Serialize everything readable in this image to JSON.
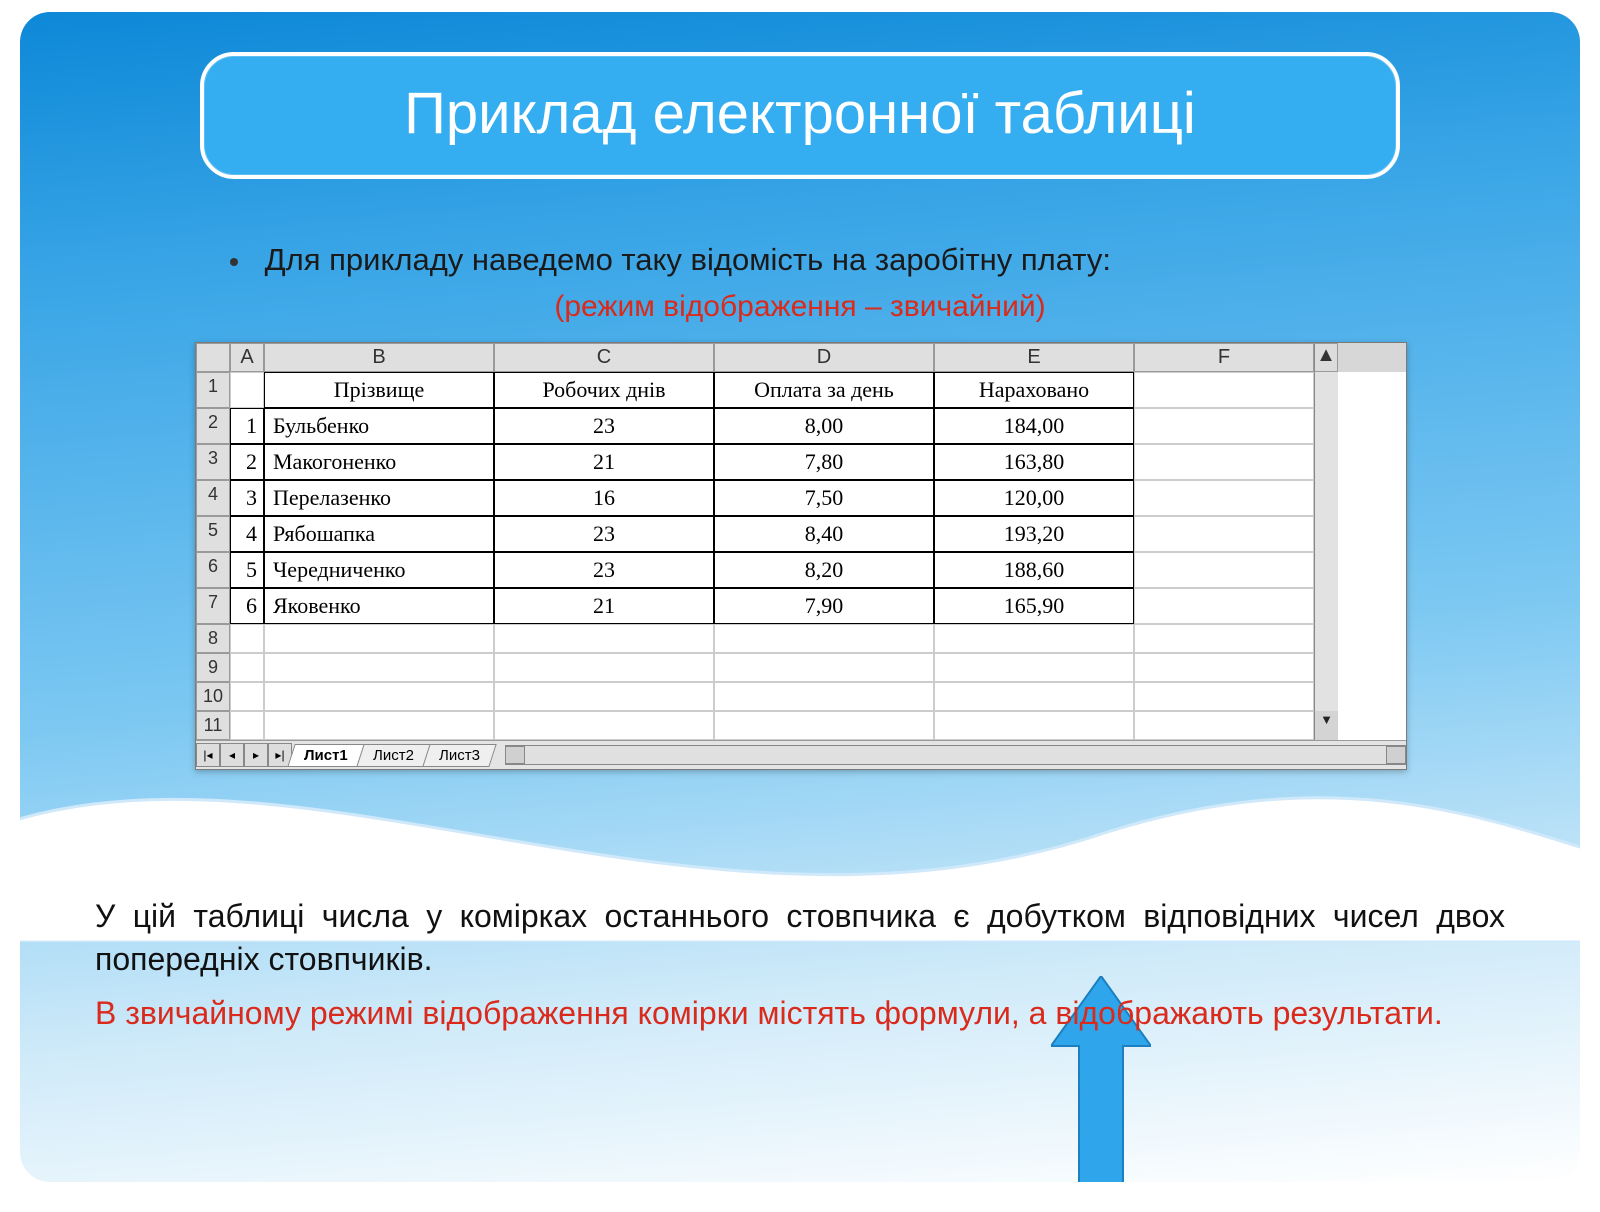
{
  "title": "Приклад електронної таблиці",
  "bullet": "Для прикладу наведемо таку відомість на заробітну плату:",
  "subnote": "(режим відображення – звичайний)",
  "columns": [
    "A",
    "B",
    "C",
    "D",
    "E",
    "F"
  ],
  "headers": {
    "b": "Прізвище",
    "c": "Робочих днів",
    "d": "Оплата за день",
    "e": "Нараховано"
  },
  "rows": [
    {
      "n": "1",
      "name": "Бульбенко",
      "days": "23",
      "rate": "8,00",
      "sum": "184,00"
    },
    {
      "n": "2",
      "name": "Макогоненко",
      "days": "21",
      "rate": "7,80",
      "sum": "163,80"
    },
    {
      "n": "3",
      "name": "Перелазенко",
      "days": "16",
      "rate": "7,50",
      "sum": "120,00"
    },
    {
      "n": "4",
      "name": "Рябошапка",
      "days": "23",
      "rate": "8,40",
      "sum": "193,20"
    },
    {
      "n": "5",
      "name": "Чередниченко",
      "days": "23",
      "rate": "8,20",
      "sum": "188,60"
    },
    {
      "n": "6",
      "name": "Яковенко",
      "days": "21",
      "rate": "7,90",
      "sum": "165,90"
    }
  ],
  "row_labels": [
    "1",
    "2",
    "3",
    "4",
    "5",
    "6",
    "7",
    "8",
    "9",
    "10",
    "11"
  ],
  "tabs": {
    "t1": "Лист1",
    "t2": "Лист2",
    "t3": "Лист3"
  },
  "para1": "У цій таблиці числа у комірках останнього стовпчика є добутком відповідних чисел двох попередніх стовпчиків.",
  "para2": "В звичайному режимі відображення комірки містять формули, а відображають результати."
}
